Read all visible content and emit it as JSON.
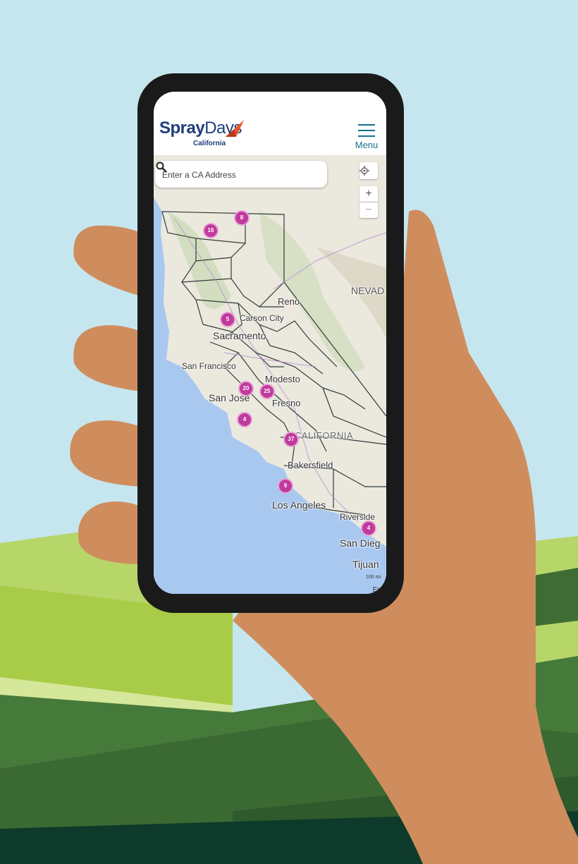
{
  "colors": {
    "sky": "#c6e6ef",
    "hand": "#cf8d5e",
    "phone_body": "#1a1a1a",
    "brand_blue": "#1f3d7a",
    "brand_accent": "#e8542a",
    "menu_teal": "#17708d",
    "cluster_fill": "#c03a9c",
    "ocean": "#a9c8f0"
  },
  "app": {
    "logo": {
      "brand_part1": "Spray",
      "brand_part2": "Days",
      "subtitle": "California",
      "icon": "paper-plane-icon"
    },
    "menu": {
      "label": "Menu",
      "icon": "hamburger-icon"
    }
  },
  "search": {
    "placeholder": "Enter a CA Address",
    "value": "",
    "icon": "search-icon"
  },
  "map_controls": {
    "locate_icon": "crosshair-icon",
    "zoom_in": "+",
    "zoom_out": "−"
  },
  "map": {
    "labels": {
      "nevada": "NEVAD",
      "reno": "Reno",
      "carson_city": "Carson City",
      "sacramento": "Sacramento",
      "san_francisco": "San Francisco",
      "modesto": "Modesto",
      "san_jose": "San Jose",
      "fresno": "Fresno",
      "california": "CALIFORNIA",
      "bakersfield": "Bakersfield",
      "los_angeles": "Los Angeles",
      "riverside": "Riverside",
      "san_diego": "San Dieg",
      "tijuana": "Tijuan"
    },
    "clusters": [
      {
        "count": "8"
      },
      {
        "count": "16"
      },
      {
        "count": "5"
      },
      {
        "count": "20"
      },
      {
        "count": "25"
      },
      {
        "count": "4"
      },
      {
        "count": "37"
      },
      {
        "count": "9"
      },
      {
        "count": "4"
      }
    ],
    "scale": "100 mi",
    "attribution": "Ens"
  }
}
